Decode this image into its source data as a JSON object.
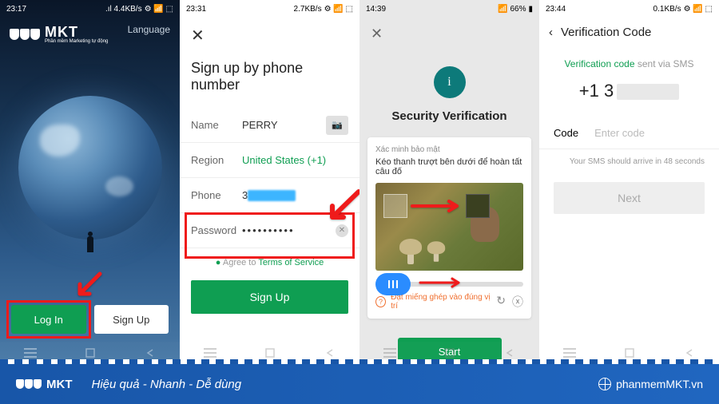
{
  "screen1": {
    "time": "23:17",
    "speed": ".ıl 4.4KB/s",
    "brand": "MKT",
    "brand_sub": "Phần mềm Marketing tự động",
    "language": "Language",
    "login": "Log In",
    "signup": "Sign Up"
  },
  "screen2": {
    "time": "23:31",
    "speed": "2.7KB/s",
    "title": "Sign up by phone number",
    "name_label": "Name",
    "name_value": "PERRY",
    "region_label": "Region",
    "region_value": "United States (+1)",
    "phone_label": "Phone",
    "phone_value": "3",
    "password_label": "Password",
    "password_value": "••••••••••",
    "tos_prefix": "Agree to",
    "tos_link": "Terms of Service",
    "signup_btn": "Sign Up"
  },
  "screen3": {
    "time": "14:39",
    "battery": "66%",
    "title": "Security Verification",
    "captcha_sub": "Xác minh bảo mật",
    "captcha_instr": "Kéo thanh trượt bên dưới để hoàn tất câu đố",
    "captcha_hint": "Đặt miếng ghép vào đúng vị trí",
    "start": "Start"
  },
  "screen4": {
    "time": "23:44",
    "speed": "0.1KB/s",
    "header": "Verification Code",
    "msg_green": "Verification code",
    "msg_grey": "sent via SMS",
    "phone": "+1 3",
    "code_label": "Code",
    "code_placeholder": "Enter code",
    "sms_note": "Your SMS should arrive in 48 seconds",
    "next": "Next"
  },
  "footer": {
    "brand": "MKT",
    "slogan": "Hiệu quả - Nhanh  - Dễ dùng",
    "url": "phanmemMKT.vn"
  }
}
